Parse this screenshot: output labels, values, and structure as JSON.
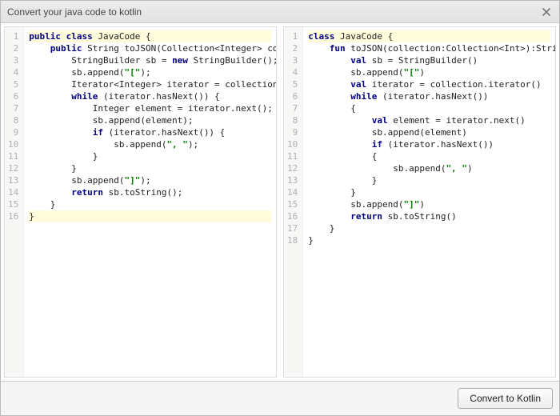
{
  "title": "Convert your java code to kotlin",
  "button_label": "Convert to Kotlin",
  "java": {
    "lines": [
      {
        "n": 1,
        "hl": true,
        "tokens": [
          [
            "kw",
            "public"
          ],
          [
            "",
            " "
          ],
          [
            "kw",
            "class"
          ],
          [
            "",
            " JavaCode {"
          ]
        ]
      },
      {
        "n": 2,
        "hl": false,
        "tokens": [
          [
            "",
            "    "
          ],
          [
            "kw",
            "public"
          ],
          [
            "",
            " String toJSON(Collection<Integer> collection) {"
          ]
        ]
      },
      {
        "n": 3,
        "hl": false,
        "tokens": [
          [
            "",
            "        StringBuilder sb = "
          ],
          [
            "kw",
            "new"
          ],
          [
            "",
            " StringBuilder();"
          ]
        ]
      },
      {
        "n": 4,
        "hl": false,
        "tokens": [
          [
            "",
            "        sb.append("
          ],
          [
            "str",
            "\"[\""
          ],
          [
            "",
            ");"
          ]
        ]
      },
      {
        "n": 5,
        "hl": false,
        "tokens": [
          [
            "",
            "        Iterator<Integer> iterator = collection.iterator();"
          ]
        ]
      },
      {
        "n": 6,
        "hl": false,
        "tokens": [
          [
            "",
            "        "
          ],
          [
            "kw",
            "while"
          ],
          [
            "",
            " (iterator.hasNext()) {"
          ]
        ]
      },
      {
        "n": 7,
        "hl": false,
        "tokens": [
          [
            "",
            "            Integer element = iterator.next();"
          ]
        ]
      },
      {
        "n": 8,
        "hl": false,
        "tokens": [
          [
            "",
            "            sb.append(element);"
          ]
        ]
      },
      {
        "n": 9,
        "hl": false,
        "tokens": [
          [
            "",
            "            "
          ],
          [
            "kw",
            "if"
          ],
          [
            "",
            " (iterator.hasNext()) {"
          ]
        ]
      },
      {
        "n": 10,
        "hl": false,
        "tokens": [
          [
            "",
            "                sb.append("
          ],
          [
            "str",
            "\", \""
          ],
          [
            "",
            ");"
          ]
        ]
      },
      {
        "n": 11,
        "hl": false,
        "tokens": [
          [
            "",
            "            }"
          ]
        ]
      },
      {
        "n": 12,
        "hl": false,
        "tokens": [
          [
            "",
            "        }"
          ]
        ]
      },
      {
        "n": 13,
        "hl": false,
        "tokens": [
          [
            "",
            "        sb.append("
          ],
          [
            "str",
            "\"]\""
          ],
          [
            "",
            ");"
          ]
        ]
      },
      {
        "n": 14,
        "hl": false,
        "tokens": [
          [
            "",
            "        "
          ],
          [
            "kw",
            "return"
          ],
          [
            "",
            " sb.toString();"
          ]
        ]
      },
      {
        "n": 15,
        "hl": false,
        "tokens": [
          [
            "",
            "    }"
          ]
        ]
      },
      {
        "n": 16,
        "hl": true,
        "tokens": [
          [
            "",
            "}"
          ]
        ]
      }
    ]
  },
  "kotlin": {
    "lines": [
      {
        "n": 1,
        "hl": true,
        "tokens": [
          [
            "kw",
            "class"
          ],
          [
            "",
            " JavaCode {"
          ]
        ]
      },
      {
        "n": 2,
        "hl": false,
        "tokens": [
          [
            "",
            "    "
          ],
          [
            "kw",
            "fun"
          ],
          [
            "",
            " toJSON(collection:Collection<Int>):String {"
          ]
        ]
      },
      {
        "n": 3,
        "hl": false,
        "tokens": [
          [
            "",
            "        "
          ],
          [
            "kw",
            "val"
          ],
          [
            "",
            " sb = StringBuilder()"
          ]
        ]
      },
      {
        "n": 4,
        "hl": false,
        "tokens": [
          [
            "",
            "        sb.append("
          ],
          [
            "str",
            "\"[\""
          ],
          [
            "",
            ")"
          ]
        ]
      },
      {
        "n": 5,
        "hl": false,
        "tokens": [
          [
            "",
            "        "
          ],
          [
            "kw",
            "val"
          ],
          [
            "",
            " iterator = collection.iterator()"
          ]
        ]
      },
      {
        "n": 6,
        "hl": false,
        "tokens": [
          [
            "",
            "        "
          ],
          [
            "kw",
            "while"
          ],
          [
            "",
            " (iterator.hasNext())"
          ]
        ]
      },
      {
        "n": 7,
        "hl": false,
        "tokens": [
          [
            "",
            "        {"
          ]
        ]
      },
      {
        "n": 8,
        "hl": false,
        "tokens": [
          [
            "",
            "            "
          ],
          [
            "kw",
            "val"
          ],
          [
            "",
            " element = iterator.next()"
          ]
        ]
      },
      {
        "n": 9,
        "hl": false,
        "tokens": [
          [
            "",
            "            sb.append(element)"
          ]
        ]
      },
      {
        "n": 10,
        "hl": false,
        "tokens": [
          [
            "",
            "            "
          ],
          [
            "kw",
            "if"
          ],
          [
            "",
            " (iterator.hasNext())"
          ]
        ]
      },
      {
        "n": 11,
        "hl": false,
        "tokens": [
          [
            "",
            "            {"
          ]
        ]
      },
      {
        "n": 12,
        "hl": false,
        "tokens": [
          [
            "",
            "                sb.append("
          ],
          [
            "str",
            "\", \""
          ],
          [
            "",
            ")"
          ]
        ]
      },
      {
        "n": 13,
        "hl": false,
        "tokens": [
          [
            "",
            "            }"
          ]
        ]
      },
      {
        "n": 14,
        "hl": false,
        "tokens": [
          [
            "",
            "        }"
          ]
        ]
      },
      {
        "n": 15,
        "hl": false,
        "tokens": [
          [
            "",
            "        sb.append("
          ],
          [
            "str",
            "\"]\""
          ],
          [
            "",
            ")"
          ]
        ]
      },
      {
        "n": 16,
        "hl": false,
        "tokens": [
          [
            "",
            "        "
          ],
          [
            "kw",
            "return"
          ],
          [
            "",
            " sb.toString()"
          ]
        ]
      },
      {
        "n": 17,
        "hl": false,
        "tokens": [
          [
            "",
            "    }"
          ]
        ]
      },
      {
        "n": 18,
        "hl": false,
        "tokens": [
          [
            "",
            "}"
          ]
        ]
      }
    ]
  }
}
